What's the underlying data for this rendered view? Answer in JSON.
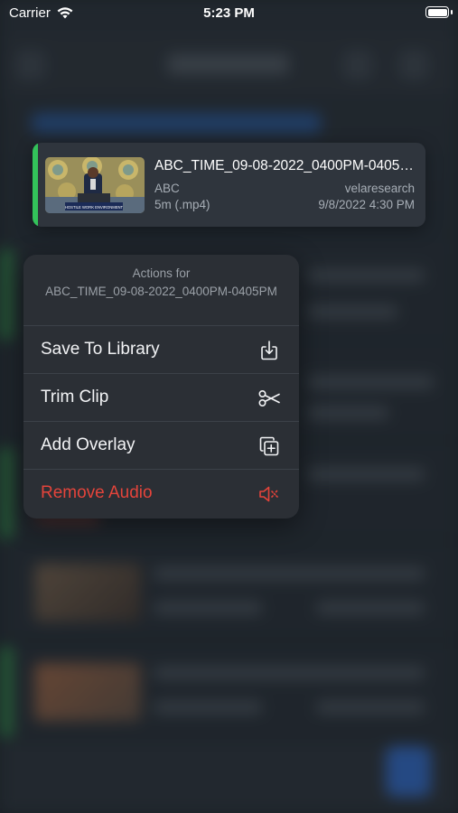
{
  "status_bar": {
    "carrier": "Carrier",
    "time": "5:23 PM",
    "wifi_icon": "wifi-icon",
    "battery_icon": "battery-icon"
  },
  "preview": {
    "title": "ABC_TIME_09-08-2022_0400PM-0405PM",
    "source": "ABC",
    "duration": "5m (.mp4)",
    "author": "velaresearch",
    "date": "9/8/2022 4:30 PM",
    "accent_color": "#33c25a",
    "thumbnail_banner": "HOSTILE WORK ENVIRONMENT"
  },
  "menu": {
    "header_label": "Actions for",
    "header_title": "ABC_TIME_09-08-2022_0400PM-0405PM",
    "items": [
      {
        "label": "Save To Library",
        "icon": "save-download-icon",
        "destructive": false
      },
      {
        "label": "Trim Clip",
        "icon": "scissors-icon",
        "destructive": false
      },
      {
        "label": "Add Overlay",
        "icon": "add-overlay-icon",
        "destructive": false
      },
      {
        "label": "Remove Audio",
        "icon": "speaker-mute-icon",
        "destructive": true
      }
    ],
    "destructive_color": "#e4443b"
  }
}
